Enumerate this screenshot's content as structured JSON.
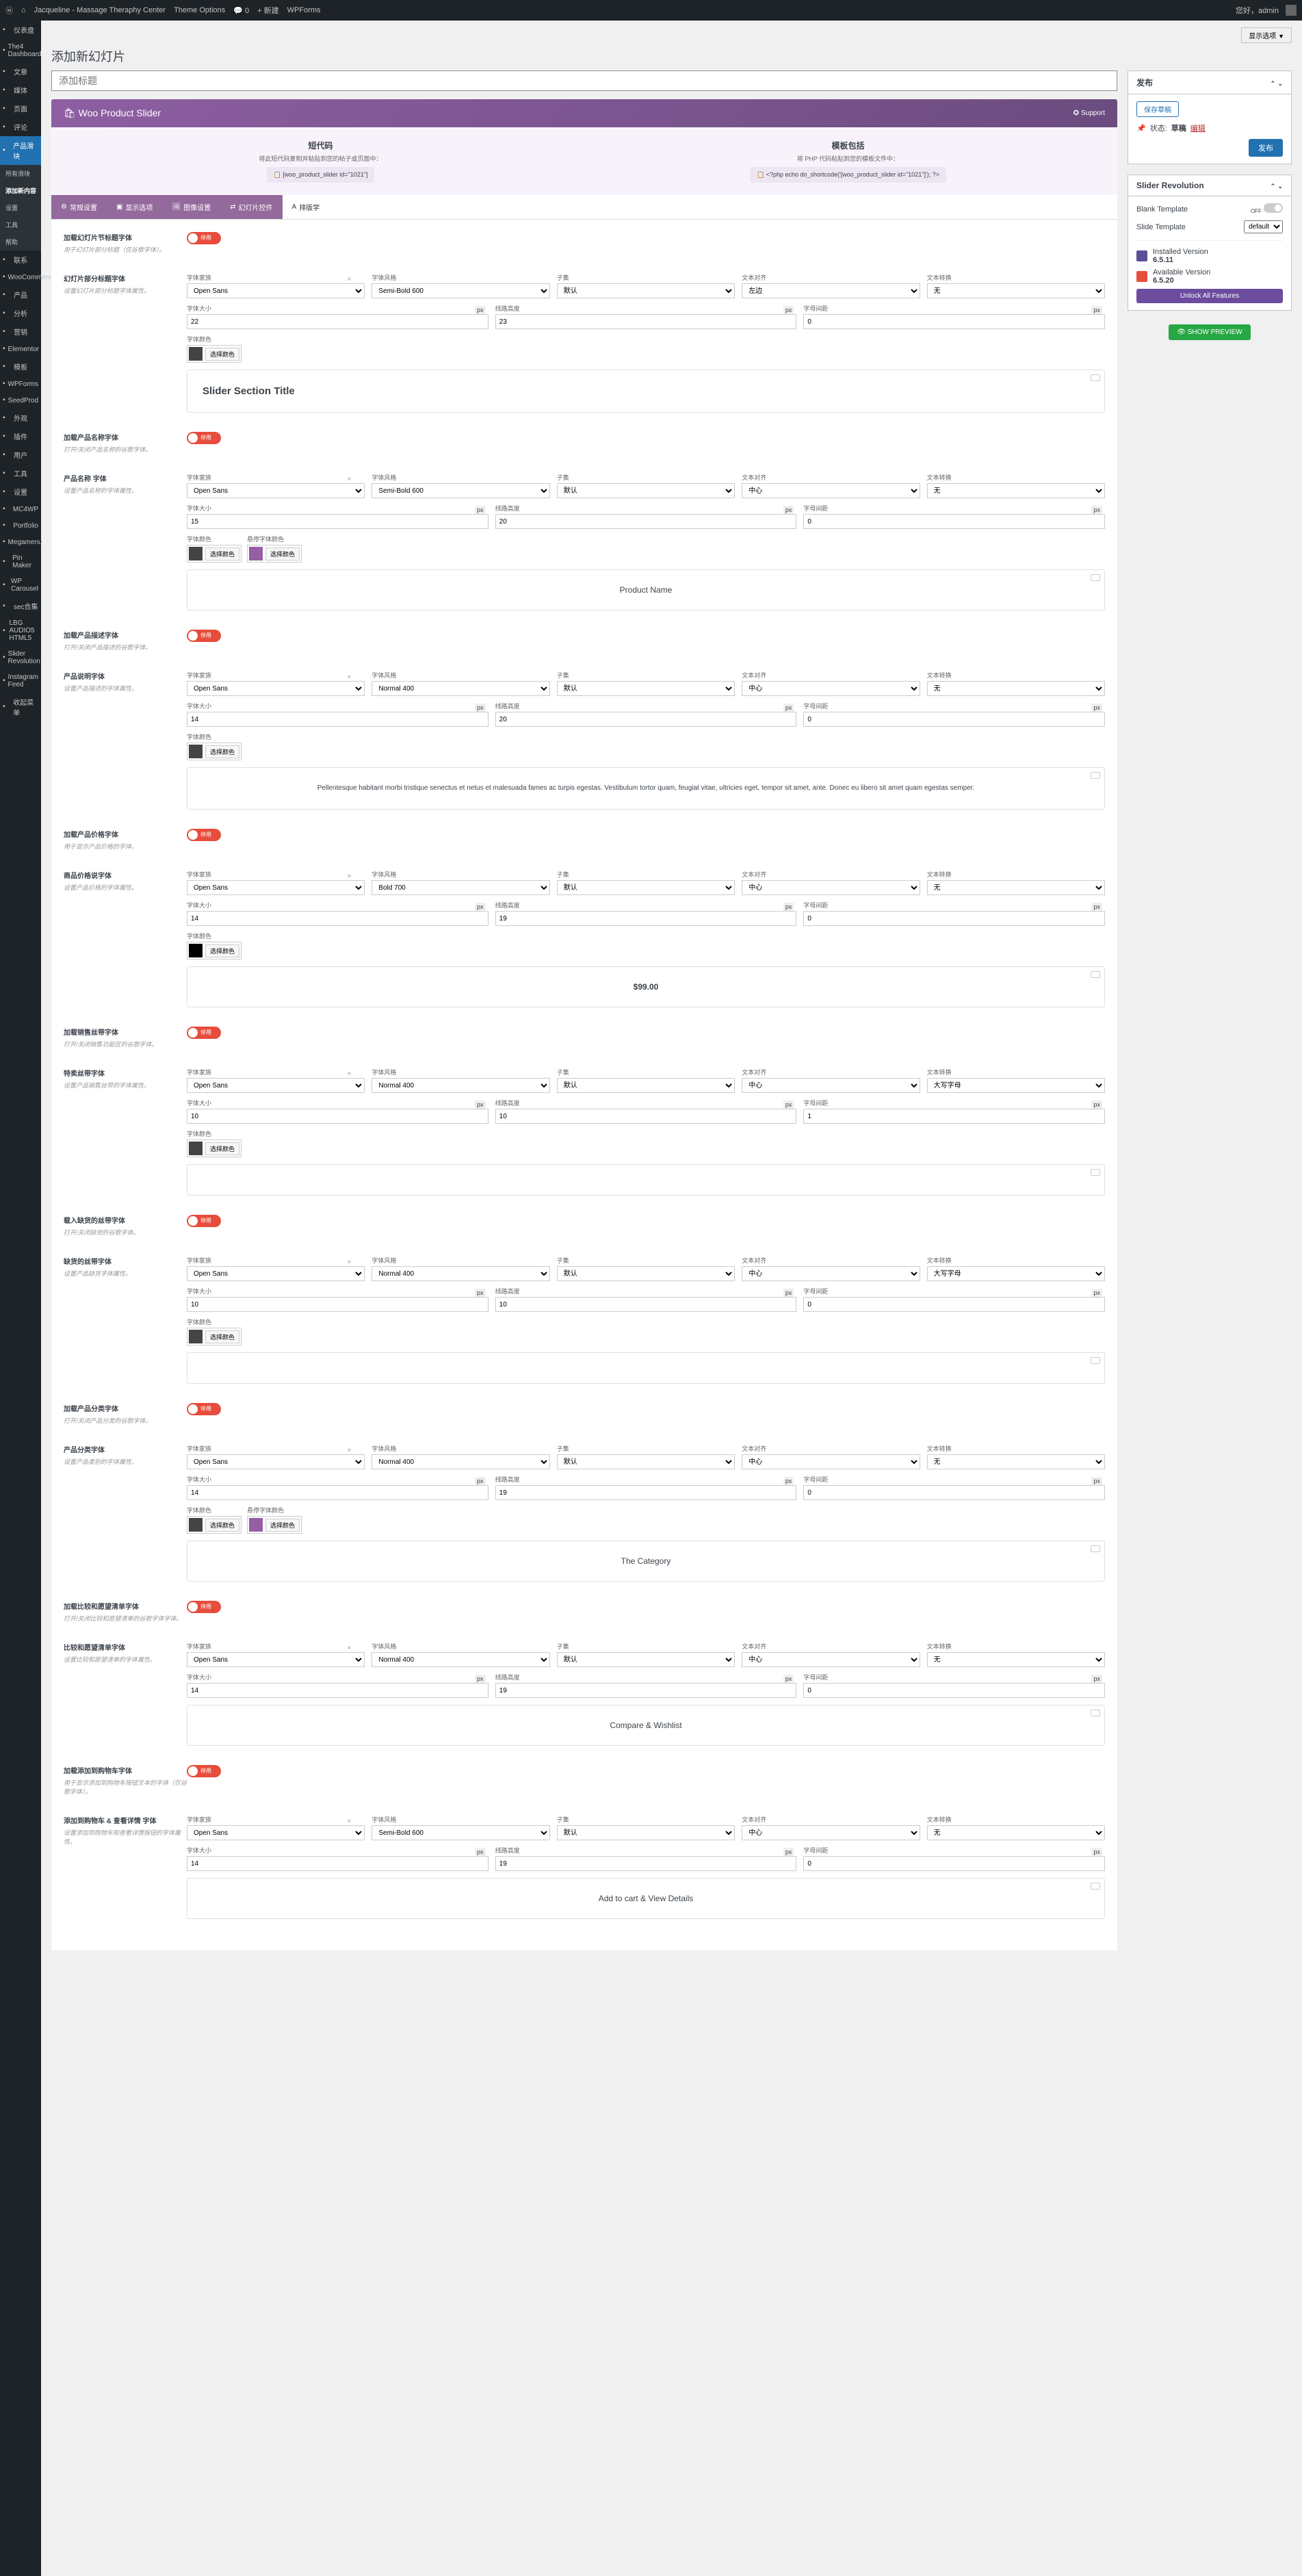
{
  "topbar": {
    "site": "Jacqueline - Massage Theraphy Center",
    "themeOpts": "Theme Options",
    "comments": "0",
    "new": "新建",
    "wpforms": "WPForms",
    "greeting": "您好，admin",
    "screenOpts": "显示选项"
  },
  "sidebar": {
    "items": [
      "仪表盘",
      "The4 Dashboard",
      "文章",
      "媒体",
      "页面",
      "评论",
      "产品滑块",
      "联系",
      "WooCommerce",
      "产品",
      "分析",
      "营销",
      "Elementor",
      "模板",
      "WPForms",
      "SeedProd",
      "外观",
      "插件",
      "用户",
      "工具",
      "设置",
      "MC4WP",
      "Portfolio",
      "Megamenu",
      "Pin Maker",
      "WP Carousel",
      "sec合集",
      "LBG AUDIO5 HTML5",
      "Slider Revolution",
      "Instagram Feed",
      "收起菜单"
    ],
    "sub": [
      "所有滑块",
      "添加新内容",
      "设置",
      "工具",
      "帮助"
    ]
  },
  "page": {
    "title": "添加新幻灯片",
    "titlePh": "添加标题"
  },
  "header": {
    "brand": "Woo Product Slider",
    "support": "Support"
  },
  "codes": {
    "sc_title": "短代码",
    "sc_desc": "将此短代码复制并粘贴到您的帖子或页面中：",
    "sc_val": "[woo_product_slider id=\"1021\"]",
    "tpl_title": "模板包括",
    "tpl_desc": "将 PHP 代码粘贴到您的模板文件中：",
    "tpl_val": "<?php echo do_shortcode('[woo_product_slider id=\"1021\"]'); ?>"
  },
  "tabs": {
    "t1": "常规设置",
    "t2": "显示选项",
    "t3": "图像设置",
    "t4": "幻灯片控件",
    "t5": "排版学"
  },
  "labels": {
    "toggle_on": "停用",
    "ff": "字体家族",
    "fw": "字体风格",
    "sub": "子集",
    "ta": "文本对齐",
    "tt": "文本转换",
    "fs": "字体大小",
    "lh": "线路高度",
    "ls": "字母间距",
    "fc": "字体颜色",
    "fhc": "悬停字体颜色",
    "pick": "选择颜色"
  },
  "opts": {
    "open_sans": "Open Sans",
    "semibold": "Semi-Bold 600",
    "normal": "Normal 400",
    "bold": "Bold 700",
    "default": "默认",
    "left": "左边",
    "center": "中心",
    "none": "无",
    "upper": "大写字母"
  },
  "sections": [
    {
      "th": "加载幻灯片节标题字体",
      "td": "用于幻灯片部分标题（仅谷歌字体）。",
      "lh": "幻灯片部分标题字体",
      "ld": "设置幻灯片部分标题字体属性。",
      "fw": "semibold",
      "ta": "left",
      "tt": "none",
      "fs": "22",
      "lh2": "23",
      "ls": "0",
      "colors": 1,
      "preview": "Slider Section Title",
      "pclass": "preview-title"
    },
    {
      "th": "加载产品名称字体",
      "td": "打开/关闭产品名称的谷歌字体。",
      "lh": "产品名称 字体",
      "ld": "设置产品名称的字体属性。",
      "fw": "semibold",
      "ta": "center",
      "tt": "none",
      "fs": "15",
      "lh2": "20",
      "ls": "0",
      "colors": 2,
      "preview": "Product Name",
      "pclass": "preview-name"
    },
    {
      "th": "加载产品描述字体",
      "td": "打开/关闭产品描述的谷歌字体。",
      "lh": "产品说明字体",
      "ld": "设置产品描述的字体属性。",
      "fw": "normal",
      "ta": "center",
      "tt": "none",
      "fs": "14",
      "lh2": "20",
      "ls": "0",
      "colors": 1,
      "preview": "Pellentesque habitant morbi tristique senectus et netus et malesuada fames ac turpis egestas. Vestibulum tortor quam, feugiat vitae, ultricies eget, tempor sit amet, ante. Donec eu libero sit amet quam egestas semper.",
      "pclass": "preview-desc"
    },
    {
      "th": "加载产品价格字体",
      "td": "用于显示产品价格的字体。",
      "lh": "商品价格说字体",
      "ld": "设置产品价格的字体属性。",
      "fw": "bold",
      "ta": "center",
      "tt": "none",
      "fs": "14",
      "lh2": "19",
      "ls": "0",
      "colors": 1,
      "swatch": "#000",
      "preview": "$99.00",
      "pclass": "preview-price"
    },
    {
      "th": "加载销售丝带字体",
      "td": "打开/关闭销售功能区的谷歌字体。",
      "lh": "特卖丝带字体",
      "ld": "设置产品销售丝带的字体属性。",
      "fw": "normal",
      "ta": "center",
      "tt": "upper",
      "fs": "10",
      "lh2": "10",
      "ls": "1",
      "colors": 1,
      "preview": "",
      "pclass": ""
    },
    {
      "th": "载入缺货的丝带字体",
      "td": "打开/关闭缺货的谷歌字体。",
      "lh": "缺货的丝带字体",
      "ld": "设置产品缺货字体属性。",
      "fw": "normal",
      "ta": "center",
      "tt": "upper",
      "fs": "10",
      "lh2": "10",
      "ls": "0",
      "colors": 1,
      "preview": "",
      "pclass": ""
    },
    {
      "th": "加载产品分类字体",
      "td": "打开/关闭产品分类的谷歌字体。",
      "lh": "产品分类字体",
      "ld": "设置产品类别的字体属性。",
      "fw": "normal",
      "ta": "center",
      "tt": "none",
      "fs": "14",
      "lh2": "19",
      "ls": "0",
      "colors": 2,
      "preview": "The Category",
      "pclass": ""
    },
    {
      "th": "加载比较和愿望清单字体",
      "td": "打开/关闭比较和愿望清单的谷歌字体字体。",
      "lh": "比较和愿望清单字体",
      "ld": "设置比较和愿望清单的字体属性。",
      "fw": "normal",
      "ta": "center",
      "tt": "none",
      "fs": "14",
      "lh2": "19",
      "ls": "0",
      "colors": 0,
      "preview": "Compare & Wishlist",
      "pclass": ""
    },
    {
      "th": "加载添加到购物车字体",
      "td": "用于显示添加到购物车按钮文本的字体（仅谷歌字体）。",
      "lh": "添加到购物车 & 查看详情 字体",
      "ld": "设置添加到购物车和查看详情按钮的字体属性。",
      "fw": "semibold",
      "ta": "center",
      "tt": "none",
      "fs": "14",
      "lh2": "19",
      "ls": "0",
      "colors": 0,
      "preview": "Add to cart & View Details",
      "pclass": ""
    }
  ],
  "publish": {
    "title": "发布",
    "saveDraft": "保存草稿",
    "status": "状态:",
    "draft": "草稿",
    "edit": "编辑",
    "btn": "发布"
  },
  "revslider": {
    "title": "Slider Revolution",
    "blank": "Blank Template",
    "off": "OFF",
    "slidetpl": "Slide Template",
    "default": "default",
    "iv": "Installed Version",
    "ivn": "6.5.11",
    "av": "Available Version",
    "avn": "6.5.20",
    "unlock": "Unlock All Features"
  },
  "preview": "SHOW PREVIEW"
}
